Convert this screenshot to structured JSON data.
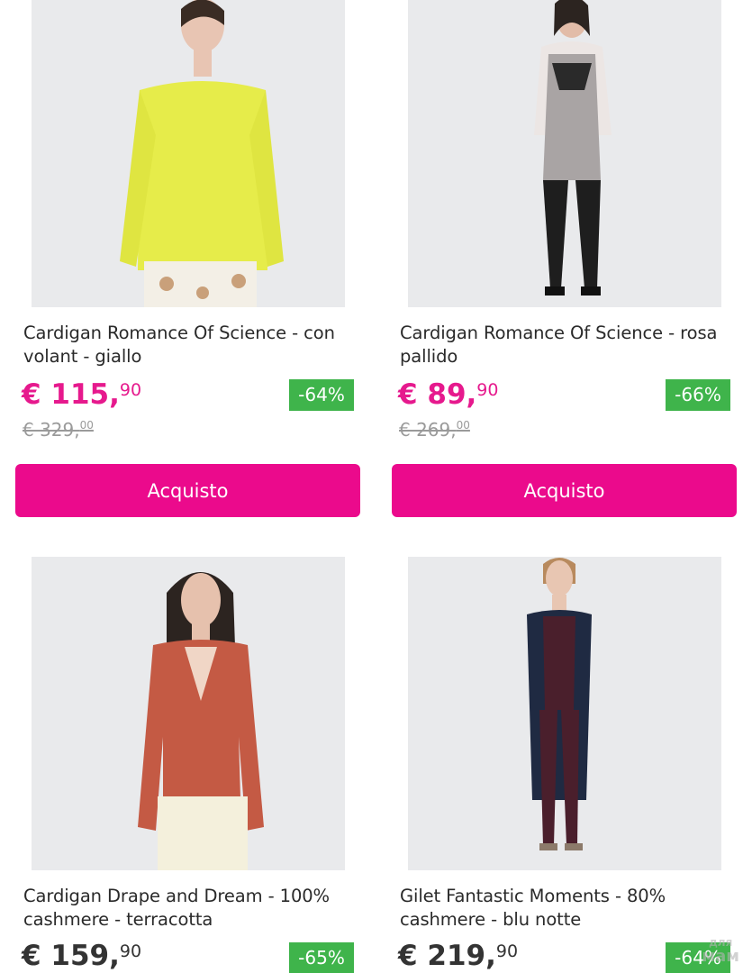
{
  "products": [
    {
      "title": "Cardigan Romance Of Science - con volant - giallo",
      "price_currency": "€",
      "price_int": "115,",
      "price_dec": "90",
      "old_price_int": "€ 329,",
      "old_price_dec": "00",
      "discount": "-64%",
      "buy_label": "Acquisto",
      "garment_color": "#e6ec4a",
      "bottom_color": "#f3efe6"
    },
    {
      "title": "Cardigan Romance Of Science - rosa pallido",
      "price_currency": "€",
      "price_int": "89,",
      "price_dec": "90",
      "old_price_int": "€ 269,",
      "old_price_dec": "00",
      "discount": "-66%",
      "buy_label": "Acquisto",
      "garment_color": "#ece6e4",
      "bottom_color": "#1e1e1e"
    },
    {
      "title": "Cardigan Drape and Dream - 100% cashmere - terracotta",
      "price_currency": "€",
      "price_int": "159,",
      "price_dec": "90",
      "discount": "-65%",
      "garment_color": "#c45a44",
      "bottom_color": "#f4f0dc"
    },
    {
      "title": "Gilet Fantastic Moments - 80% cashmere - blu notte",
      "price_currency": "€",
      "price_int": "219,",
      "price_dec": "90",
      "discount": "-64%",
      "garment_color": "#1f2a42",
      "bottom_color": "#4a1f2c"
    }
  ],
  "colors": {
    "accent": "#eb0a8c",
    "price": "#e6198d",
    "badge": "#3fb44b"
  },
  "watermark": {
    "line1": "для",
    "line2": "мам"
  }
}
